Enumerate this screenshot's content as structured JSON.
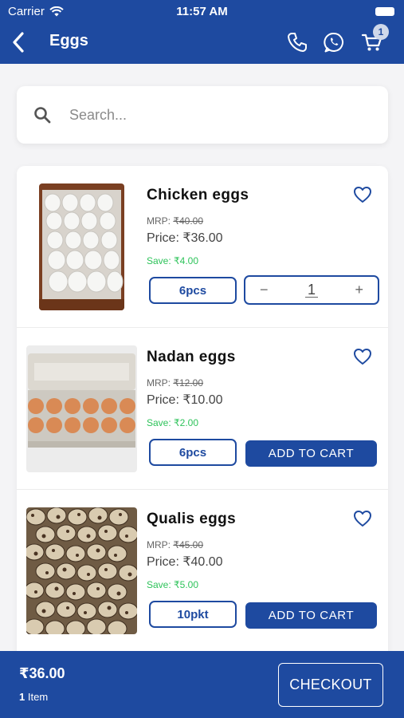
{
  "status_bar": {
    "carrier": "Carrier",
    "time": "11:57 AM"
  },
  "header": {
    "title": "Eggs",
    "cart_count": "1"
  },
  "search": {
    "placeholder": "Search..."
  },
  "products": [
    {
      "name": "Chicken eggs",
      "mrp_label": "MRP:",
      "mrp": "₹40.00",
      "price": "Price: ₹36.00",
      "save": "Save: ₹4.00",
      "unit": "6pcs",
      "quantity": "1",
      "minus": "−",
      "plus": "+"
    },
    {
      "name": "Nadan eggs",
      "mrp_label": "MRP:",
      "mrp": "₹12.00",
      "price": "Price: ₹10.00",
      "save": "Save: ₹2.00",
      "unit": "6pcs",
      "add_label": "ADD TO CART"
    },
    {
      "name": "Qualis eggs",
      "mrp_label": "MRP:",
      "mrp": "₹45.00",
      "price": "Price: ₹40.00",
      "save": "Save: ₹5.00",
      "unit": "10pkt",
      "add_label": "ADD TO CART"
    }
  ],
  "footer": {
    "total": "₹36.00",
    "item_count": "1",
    "item_label": "Item",
    "checkout_label": "CHECKOUT"
  },
  "colors": {
    "primary": "#1e4aa0",
    "save_green": "#2ec35a",
    "background": "#f4f4f6"
  }
}
